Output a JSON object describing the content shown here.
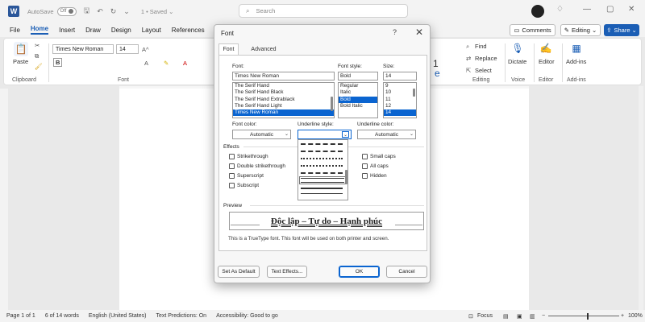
{
  "titlebar": {
    "logo": "W",
    "autosave_label": "AutoSave",
    "autosave_state": "Off",
    "doc_status": "1 • Saved ⌄",
    "search_placeholder": "Search"
  },
  "menubar": {
    "items": [
      "File",
      "Home",
      "Insert",
      "Draw",
      "Design",
      "Layout",
      "References"
    ],
    "active": "Home",
    "comments_label": "Comments",
    "editing_label": "Editing",
    "share_label": "Share"
  },
  "ribbon": {
    "paste_label": "Paste",
    "clipboard_label": "Clipboard",
    "font_group_label": "Font",
    "font_name": "Times New Roman",
    "font_size": "14",
    "find_label": "Find",
    "replace_label": "Replace",
    "select_label": "Select",
    "editing_group_label": "Editing",
    "dictate_label": "Dictate",
    "voice_label": "Voice",
    "editor_label": "Editor",
    "editor_group_label": "Editor",
    "addins_label": "Add-ins",
    "addins_group_label": "Add-ins",
    "partial_style_number": "1",
    "partial_style_letter": "e"
  },
  "statusbar": {
    "page": "Page 1 of 1",
    "words": "6 of 14 words",
    "language": "English (United States)",
    "predictions": "Text Predictions: On",
    "accessibility": "Accessibility: Good to go",
    "focus": "Focus",
    "zoom": "100%"
  },
  "dialog": {
    "title": "Font",
    "help": "?",
    "tabs": [
      "Font",
      "Advanced"
    ],
    "active_tab": "Font",
    "font_label": "Font:",
    "font_value": "Times New Roman",
    "font_list": [
      "The Serif Hand",
      "The Serif Hand Black",
      "The Serif Hand Extrablack",
      "The Serif Hand Light",
      "Times New Roman"
    ],
    "font_selected": "Times New Roman",
    "style_label": "Font style:",
    "style_value": "Bold",
    "style_list": [
      "Regular",
      "Italic",
      "Bold",
      "Bold Italic"
    ],
    "style_selected": "Bold",
    "size_label": "Size:",
    "size_value": "14",
    "size_list": [
      "9",
      "10",
      "11",
      "12",
      "14"
    ],
    "size_selected": "14",
    "font_color_label": "Font color:",
    "font_color_value": "Automatic",
    "underline_style_label": "Underline style:",
    "underline_color_label": "Underline color:",
    "underline_color_value": "Automatic",
    "effects_label": "Effects",
    "effects_left": [
      "Strikethrough",
      "Double strikethrough",
      "Superscript",
      "Subscript"
    ],
    "effects_right": [
      "Small caps",
      "All caps",
      "Hidden"
    ],
    "preview_label": "Preview",
    "preview_text": "Độc lập – Tự do – Hạnh phúc",
    "note": "This is a TrueType font. This font will be used on both printer and screen.",
    "set_default_label": "Set As Default",
    "text_effects_label": "Text Effects...",
    "ok_label": "OK",
    "cancel_label": "Cancel"
  }
}
